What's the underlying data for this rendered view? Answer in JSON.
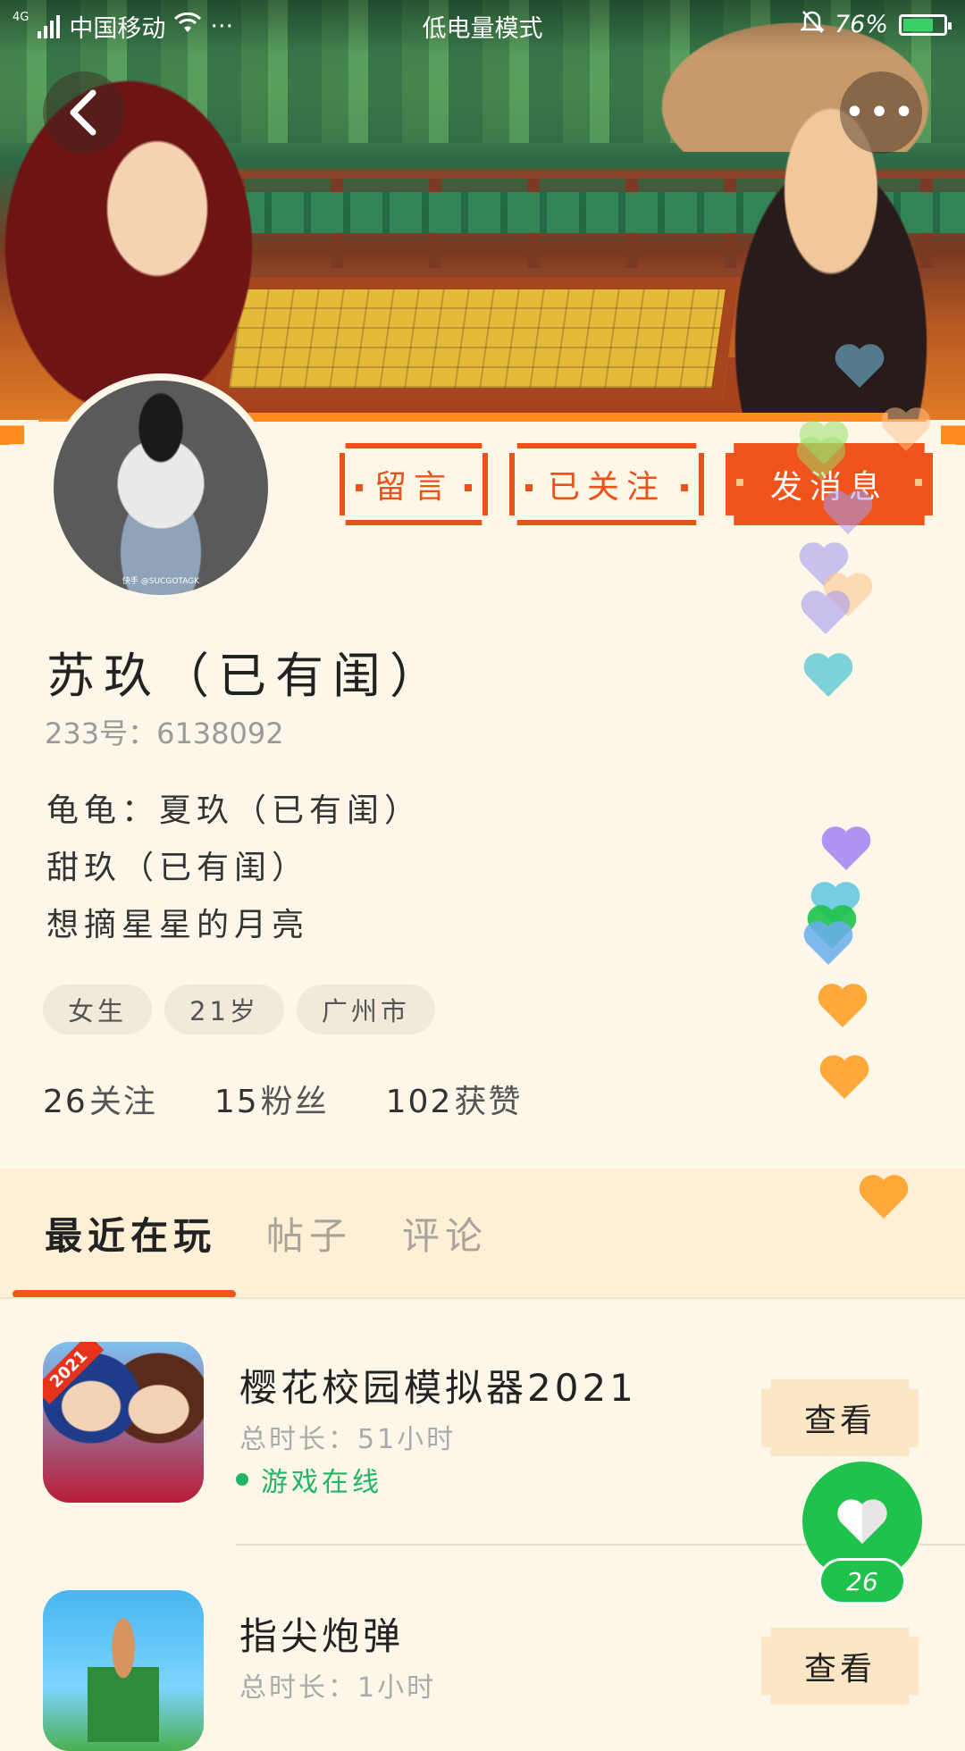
{
  "status_bar": {
    "network": "4G",
    "carrier": "中国移动",
    "more": "···",
    "mode": "低电量模式",
    "battery": "76%",
    "battery_level": 0.76
  },
  "header": {
    "back_icon": "chevron-left-icon",
    "more_icon": "more-dots-icon",
    "more_label": "•••"
  },
  "profile": {
    "avatar_watermark": "快手 @SUCGOTAGK",
    "nickname": "苏玖（已有闺）",
    "uid": "233号：6138092",
    "bio_lines": [
      "龟龟：夏玖（已有闺）",
      "甜玖（已有闺）",
      "想摘星星的月亮"
    ],
    "tags": [
      "女生",
      "21岁",
      "广州市"
    ],
    "stats": [
      {
        "num": "26",
        "label": "关注"
      },
      {
        "num": "15",
        "label": "粉丝"
      },
      {
        "num": "102",
        "label": "获赞"
      }
    ]
  },
  "actions": {
    "message": "留言",
    "follow": "已关注",
    "send": "发消息"
  },
  "tabs": [
    "最近在玩",
    "帖子",
    "评论"
  ],
  "games": [
    {
      "title": "樱花校园模拟器2021",
      "duration": "总时长：51小时",
      "online": "游戏在线",
      "badge": "2021",
      "view": "查看"
    },
    {
      "title": "指尖炮弹",
      "duration": "总时长：1小时",
      "view": "查看"
    }
  ],
  "like": {
    "icon": "heart-icon",
    "count": "26",
    "color": "#1fc24b"
  },
  "colors": {
    "accent": "#f0541b",
    "background": "#fdf7e9",
    "online": "#22b563"
  }
}
